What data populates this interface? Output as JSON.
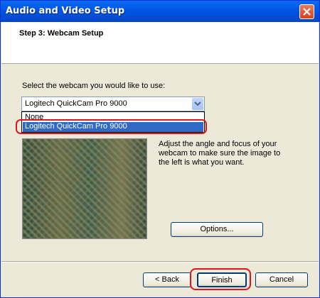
{
  "window": {
    "title": "Audio and Video Setup"
  },
  "header": {
    "step_title": "Step 3: Webcam Setup"
  },
  "webcam": {
    "select_label": "Select the webcam you would like to use:",
    "selected_value": "Logitech QuickCam Pro 9000",
    "options": [
      "None",
      "Logitech QuickCam Pro 9000"
    ]
  },
  "instructions": "Adjust the angle and focus of your webcam to make sure the image to the left is what you want.",
  "buttons": {
    "options_label": "Options...",
    "back_label": "< Back",
    "finish_label": "Finish",
    "cancel_label": "Cancel"
  },
  "colors": {
    "highlight_ring": "#e0141e",
    "selection": "#316ac5",
    "titlebar": "#0058e6"
  }
}
